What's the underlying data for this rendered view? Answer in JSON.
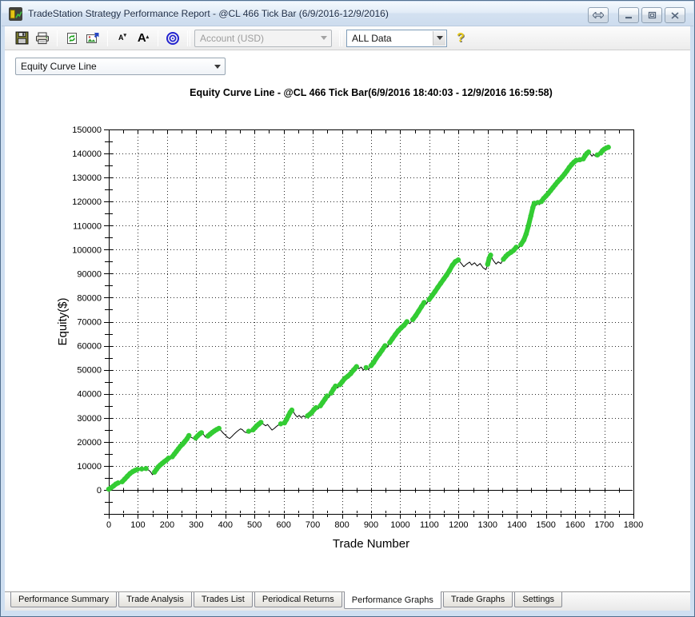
{
  "window": {
    "title": "TradeStation Strategy Performance Report - @CL 466 Tick Bar (6/9/2016-12/9/2016)"
  },
  "toolbar": {
    "account_dropdown": "Account (USD)",
    "data_dropdown": "ALL Data",
    "font_decrease_label": "A",
    "font_increase_label": "A",
    "help_label": "?"
  },
  "graph_selector": {
    "value": "Equity Curve Line"
  },
  "chart_data": {
    "type": "line",
    "title": "Equity Curve Line - @CL 466 Tick Bar(6/9/2016 18:40:03 - 12/9/2016 16:59:58)",
    "xlabel": "Trade Number",
    "ylabel": "Equity($)",
    "xlim": [
      0,
      1800
    ],
    "ylim": [
      -10000,
      150000
    ],
    "x_ticks": [
      0,
      100,
      200,
      300,
      400,
      500,
      600,
      700,
      800,
      900,
      1000,
      1100,
      1200,
      1300,
      1400,
      1500,
      1600,
      1700,
      1800
    ],
    "y_ticks": [
      0,
      10000,
      20000,
      30000,
      40000,
      50000,
      60000,
      70000,
      80000,
      90000,
      100000,
      110000,
      120000,
      130000,
      140000,
      150000
    ],
    "grid": "dotted",
    "legend": "none",
    "marker_rule": "green dot markers on rising segments that make (or lead into) new equity highs",
    "colors": {
      "line": "#000000",
      "marker": "#33cc33"
    },
    "series": [
      {
        "name": "Equity",
        "points": [
          [
            0,
            300
          ],
          [
            8,
            900
          ],
          [
            16,
            1600
          ],
          [
            24,
            2400
          ],
          [
            32,
            2900
          ],
          [
            38,
            2400
          ],
          [
            46,
            3400
          ],
          [
            55,
            4500
          ],
          [
            64,
            5700
          ],
          [
            73,
            6800
          ],
          [
            82,
            7600
          ],
          [
            90,
            8100
          ],
          [
            98,
            8500
          ],
          [
            106,
            8200
          ],
          [
            113,
            8700
          ],
          [
            121,
            8200
          ],
          [
            128,
            8900
          ],
          [
            136,
            8300
          ],
          [
            143,
            7600
          ],
          [
            150,
            6300
          ],
          [
            157,
            7400
          ],
          [
            164,
            8600
          ],
          [
            170,
            9600
          ],
          [
            177,
            10400
          ],
          [
            184,
            11100
          ],
          [
            191,
            11800
          ],
          [
            198,
            12400
          ],
          [
            205,
            13200
          ],
          [
            211,
            12700
          ],
          [
            218,
            13800
          ],
          [
            225,
            14900
          ],
          [
            232,
            16000
          ],
          [
            239,
            17100
          ],
          [
            246,
            18200
          ],
          [
            253,
            19000
          ],
          [
            258,
            19700
          ],
          [
            262,
            20300
          ],
          [
            268,
            21200
          ],
          [
            275,
            22600
          ],
          [
            282,
            21900
          ],
          [
            290,
            21400
          ],
          [
            298,
            21600
          ],
          [
            305,
            22500
          ],
          [
            312,
            23300
          ],
          [
            318,
            23800
          ],
          [
            325,
            23100
          ],
          [
            332,
            21900
          ],
          [
            340,
            22400
          ],
          [
            348,
            23200
          ],
          [
            355,
            23900
          ],
          [
            362,
            24500
          ],
          [
            370,
            25100
          ],
          [
            378,
            25600
          ],
          [
            385,
            24700
          ],
          [
            393,
            23600
          ],
          [
            400,
            22800
          ],
          [
            408,
            21800
          ],
          [
            415,
            21400
          ],
          [
            423,
            22300
          ],
          [
            430,
            23200
          ],
          [
            438,
            24100
          ],
          [
            445,
            24800
          ],
          [
            452,
            25400
          ],
          [
            458,
            25100
          ],
          [
            465,
            24200
          ],
          [
            472,
            23800
          ],
          [
            480,
            24400
          ],
          [
            488,
            24100
          ],
          [
            495,
            25000
          ],
          [
            502,
            25900
          ],
          [
            508,
            26700
          ],
          [
            515,
            27400
          ],
          [
            522,
            28100
          ],
          [
            530,
            27400
          ],
          [
            538,
            26700
          ],
          [
            545,
            27200
          ],
          [
            552,
            26100
          ],
          [
            560,
            24900
          ],
          [
            568,
            25600
          ],
          [
            575,
            26400
          ],
          [
            582,
            27000
          ],
          [
            590,
            27500
          ],
          [
            597,
            27200
          ],
          [
            603,
            27900
          ],
          [
            610,
            29300
          ],
          [
            616,
            30800
          ],
          [
            622,
            32200
          ],
          [
            628,
            33200
          ],
          [
            634,
            32300
          ],
          [
            640,
            31200
          ],
          [
            647,
            30300
          ],
          [
            653,
            31000
          ],
          [
            660,
            30100
          ],
          [
            668,
            30800
          ],
          [
            675,
            30200
          ],
          [
            682,
            30800
          ],
          [
            690,
            31500
          ],
          [
            697,
            32300
          ],
          [
            704,
            33400
          ],
          [
            711,
            34200
          ],
          [
            718,
            33600
          ],
          [
            726,
            35000
          ],
          [
            734,
            36400
          ],
          [
            742,
            37800
          ],
          [
            749,
            39100
          ],
          [
            755,
            38400
          ],
          [
            763,
            40300
          ],
          [
            771,
            42000
          ],
          [
            778,
            43200
          ],
          [
            785,
            42400
          ],
          [
            793,
            43800
          ],
          [
            801,
            45000
          ],
          [
            810,
            46400
          ],
          [
            820,
            47300
          ],
          [
            830,
            48400
          ],
          [
            840,
            49900
          ],
          [
            850,
            51300
          ],
          [
            858,
            50400
          ],
          [
            866,
            51100
          ],
          [
            874,
            49800
          ],
          [
            883,
            50900
          ],
          [
            891,
            50000
          ],
          [
            900,
            51700
          ],
          [
            909,
            53100
          ],
          [
            918,
            54900
          ],
          [
            928,
            56500
          ],
          [
            938,
            58200
          ],
          [
            948,
            60000
          ],
          [
            955,
            59300
          ],
          [
            964,
            61300
          ],
          [
            973,
            62900
          ],
          [
            983,
            64600
          ],
          [
            993,
            66200
          ],
          [
            1003,
            67400
          ],
          [
            1013,
            68500
          ],
          [
            1023,
            70000
          ],
          [
            1033,
            69200
          ],
          [
            1043,
            70900
          ],
          [
            1053,
            72500
          ],
          [
            1063,
            74400
          ],
          [
            1073,
            76300
          ],
          [
            1082,
            78000
          ],
          [
            1089,
            77300
          ],
          [
            1099,
            79200
          ],
          [
            1109,
            80800
          ],
          [
            1119,
            82500
          ],
          [
            1129,
            84300
          ],
          [
            1139,
            86000
          ],
          [
            1149,
            87700
          ],
          [
            1159,
            89400
          ],
          [
            1169,
            91300
          ],
          [
            1179,
            93500
          ],
          [
            1189,
            95000
          ],
          [
            1199,
            95700
          ],
          [
            1209,
            94300
          ],
          [
            1218,
            92900
          ],
          [
            1228,
            94000
          ],
          [
            1238,
            94800
          ],
          [
            1245,
            93600
          ],
          [
            1255,
            94500
          ],
          [
            1264,
            93200
          ],
          [
            1274,
            94200
          ],
          [
            1284,
            92500
          ],
          [
            1294,
            91700
          ],
          [
            1300,
            93900
          ],
          [
            1305,
            96300
          ],
          [
            1310,
            97700
          ],
          [
            1319,
            95500
          ],
          [
            1329,
            94000
          ],
          [
            1336,
            94900
          ],
          [
            1345,
            94200
          ],
          [
            1354,
            96000
          ],
          [
            1363,
            97300
          ],
          [
            1370,
            98100
          ],
          [
            1380,
            98900
          ],
          [
            1389,
            99700
          ],
          [
            1398,
            101000
          ],
          [
            1405,
            100400
          ],
          [
            1414,
            102100
          ],
          [
            1424,
            104000
          ],
          [
            1432,
            106500
          ],
          [
            1440,
            110000
          ],
          [
            1448,
            114000
          ],
          [
            1455,
            117500
          ],
          [
            1460,
            119300
          ],
          [
            1466,
            118400
          ],
          [
            1472,
            119600
          ],
          [
            1478,
            118700
          ],
          [
            1484,
            120000
          ],
          [
            1492,
            121300
          ],
          [
            1500,
            122300
          ],
          [
            1508,
            123400
          ],
          [
            1516,
            124600
          ],
          [
            1524,
            125800
          ],
          [
            1532,
            127000
          ],
          [
            1540,
            128200
          ],
          [
            1548,
            129200
          ],
          [
            1556,
            130300
          ],
          [
            1564,
            131500
          ],
          [
            1572,
            132800
          ],
          [
            1580,
            134200
          ],
          [
            1588,
            135400
          ],
          [
            1596,
            136400
          ],
          [
            1604,
            137200
          ],
          [
            1610,
            136500
          ],
          [
            1616,
            137400
          ],
          [
            1622,
            136800
          ],
          [
            1628,
            137800
          ],
          [
            1634,
            139000
          ],
          [
            1640,
            140000
          ],
          [
            1646,
            140600
          ],
          [
            1652,
            139800
          ],
          [
            1658,
            138900
          ],
          [
            1664,
            139600
          ],
          [
            1670,
            138800
          ],
          [
            1676,
            139400
          ],
          [
            1682,
            138800
          ],
          [
            1688,
            140200
          ],
          [
            1694,
            141200
          ],
          [
            1700,
            141800
          ],
          [
            1707,
            142300
          ],
          [
            1714,
            142600
          ]
        ]
      }
    ]
  },
  "tabs": {
    "items": [
      "Performance Summary",
      "Trade Analysis",
      "Trades List",
      "Periodical Returns",
      "Performance Graphs",
      "Trade Graphs",
      "Settings"
    ],
    "active": "Performance Graphs"
  }
}
